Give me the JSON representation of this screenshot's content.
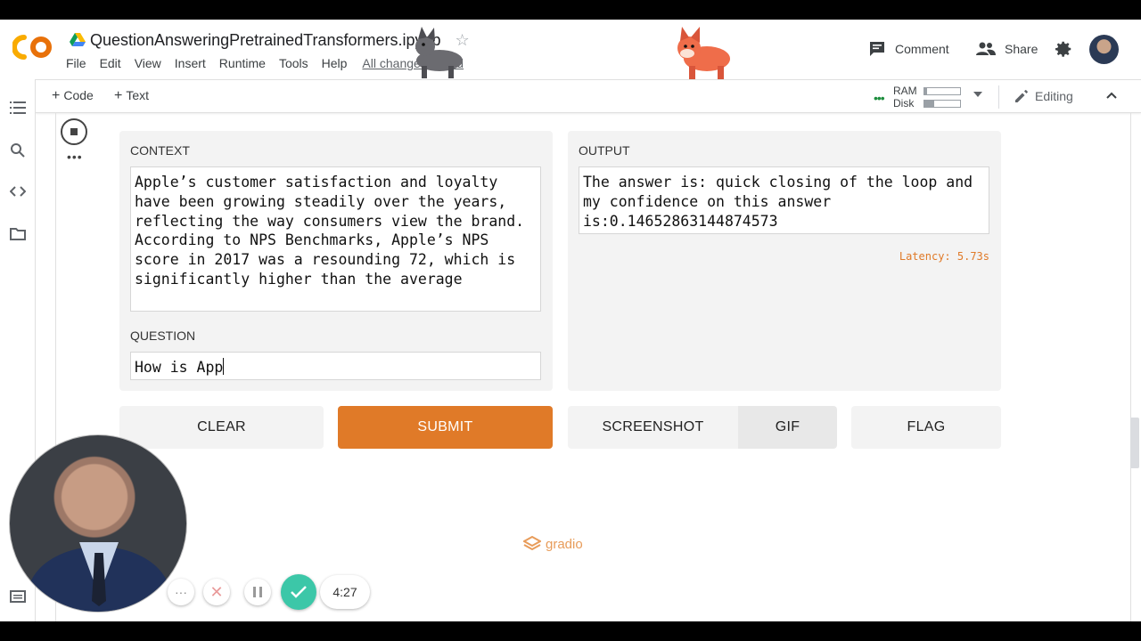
{
  "header": {
    "notebook_title": "QuestionAnsweringPretrainedTransformers.ipynb",
    "menu": [
      "File",
      "Edit",
      "View",
      "Insert",
      "Runtime",
      "Tools",
      "Help"
    ],
    "save_status": "All changes saved",
    "comment_label": "Comment",
    "share_label": "Share"
  },
  "toolbar": {
    "add_code_label": "Code",
    "add_text_label": "Text",
    "ram_label": "RAM",
    "disk_label": "Disk",
    "ram_usage": 0.08,
    "disk_usage": 0.28,
    "mode_label": "Editing"
  },
  "gradio": {
    "context_label": "CONTEXT",
    "context_text": "Apple’s customer satisfaction and loyalty have been growing steadily over the years, reflecting the way consumers view the brand. According to NPS Benchmarks, Apple’s NPS score in 2017 was a resounding 72, which is significantly higher than the average",
    "question_label": "QUESTION",
    "question_text": "How is App",
    "output_label": "OUTPUT",
    "output_text": "The answer is: quick closing of the loop and my confidence on this answer is:0.14652863144874573",
    "latency": "Latency: 5.73s",
    "buttons": {
      "clear": "CLEAR",
      "submit": "SUBMIT",
      "screenshot": "SCREENSHOT",
      "gif": "GIF",
      "flag": "FLAG"
    },
    "brand": "gradio"
  },
  "recorder": {
    "time": "4:27",
    "more": "···"
  },
  "colors": {
    "accent": "#e07a28",
    "recorder_check": "#3cc7a8",
    "colab_logo_orange": "#f9ab00"
  }
}
